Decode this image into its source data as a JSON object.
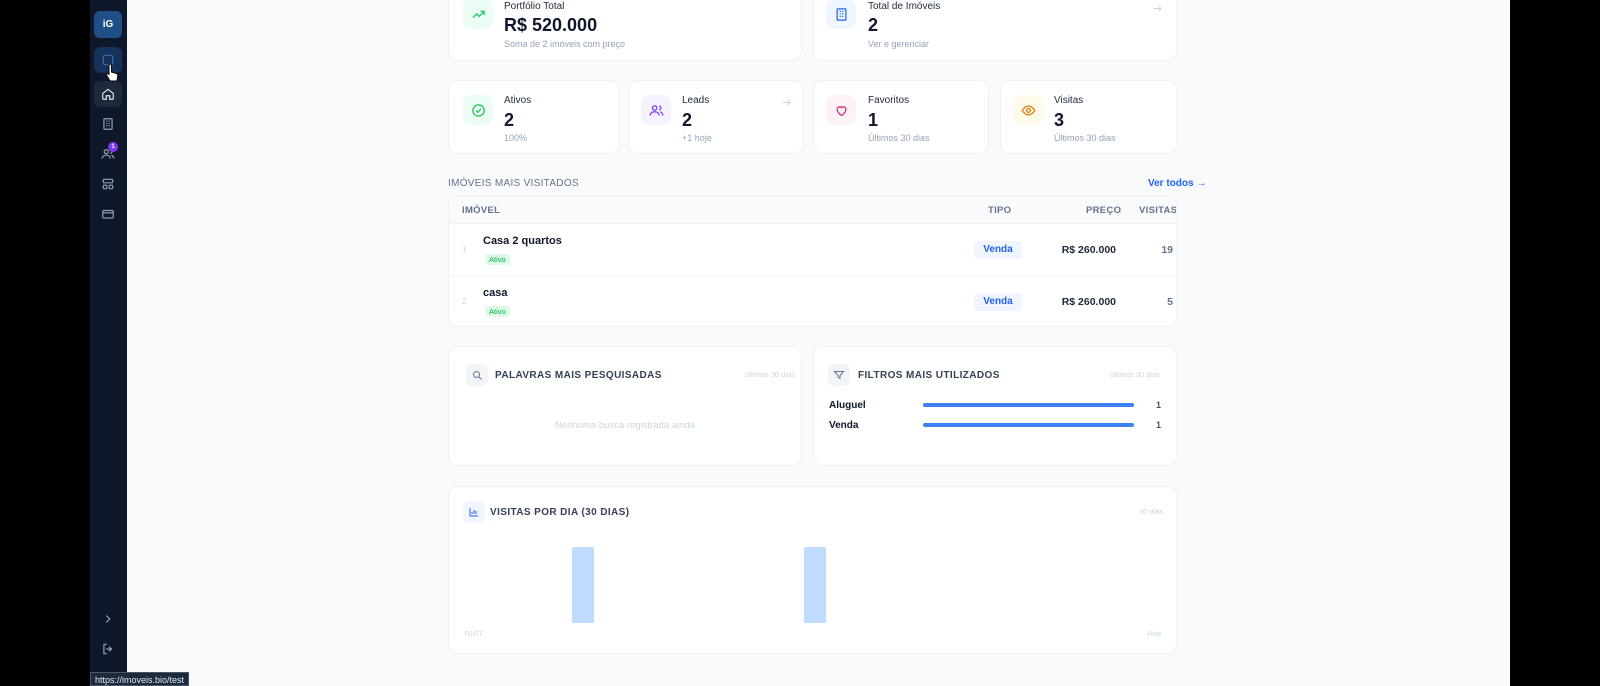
{
  "sidebar": {
    "logo": "iG",
    "notification_count": "1",
    "status_url": "https://imoveis.bio/test"
  },
  "kpis": {
    "portfolio": {
      "label": "Portfólio Total",
      "value": "R$ 520.000",
      "sub": "Soma de 2 imóveis com preço"
    },
    "total": {
      "label": "Total de Imóveis",
      "value": "2",
      "sub": "Ver e gerenciar"
    },
    "ativos": {
      "label": "Ativos",
      "value": "2",
      "sub": "100%"
    },
    "leads": {
      "label": "Leads",
      "value": "2",
      "sub": "+1 hoje"
    },
    "favoritos": {
      "label": "Favoritos",
      "value": "1",
      "sub": "Últimos 30 dias"
    },
    "visitas": {
      "label": "Visitas",
      "value": "3",
      "sub": "Últimos 30 dias"
    }
  },
  "most_visited": {
    "title": "IMÓVEIS MAIS VISITADOS",
    "see_all": "Ver todos",
    "columns": {
      "imovel": "IMÓVEL",
      "tipo": "TIPO",
      "preco": "PREÇO",
      "visitas": "VISITAS"
    },
    "rows": [
      {
        "rank": "1",
        "name": "Casa 2 quartos",
        "status": "Ativo",
        "type": "Venda",
        "price": "R$ 260.000",
        "visits": "19"
      },
      {
        "rank": "2",
        "name": "casa",
        "status": "Ativo",
        "type": "Venda",
        "price": "R$ 260.000",
        "visits": "5"
      }
    ]
  },
  "searches": {
    "title": "PALAVRAS MAIS PESQUISADAS",
    "period": "últimos 30 dias",
    "empty": "Nenhuma busca registrada ainda"
  },
  "filters": {
    "title": "FILTROS MAIS UTILIZADOS",
    "period": "últimos 30 dias",
    "items": [
      {
        "label": "Aluguel",
        "count": "1",
        "fraction": 1.0
      },
      {
        "label": "Venda",
        "count": "1",
        "fraction": 1.0
      }
    ]
  },
  "daily_visits": {
    "title": "VISITAS POR DIA (30 DIAS)",
    "period": "30 dias",
    "start_label": "01/07",
    "end_label": "Hoje",
    "bars": [
      {
        "day": 5,
        "value": 1
      },
      {
        "day": 15,
        "value": 1
      }
    ],
    "max": 1,
    "days": 30,
    "bar_color": "#bfdbfe"
  }
}
